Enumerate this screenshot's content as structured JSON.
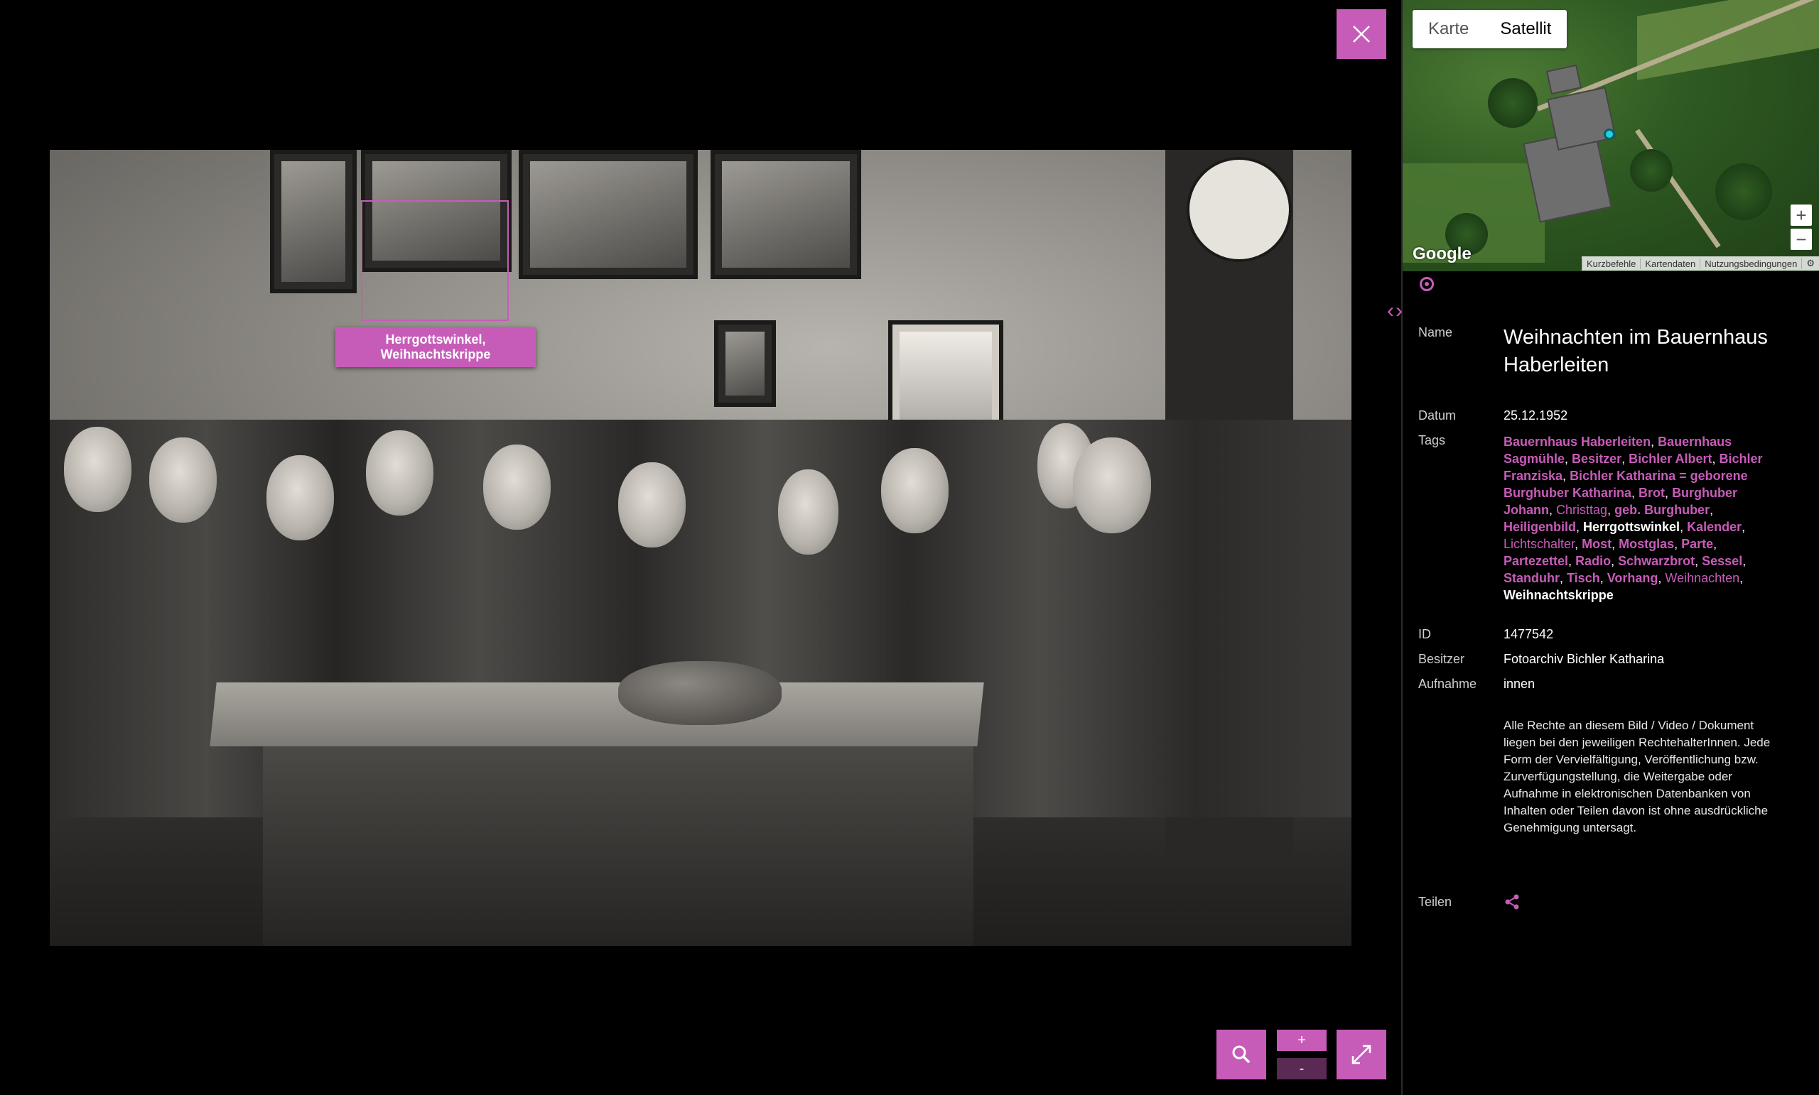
{
  "annotation": {
    "label_line1": "Herrgottswinkel,",
    "label_line2": "Weihnachtskrippe"
  },
  "viewer": {
    "close_icon": "close-icon",
    "search_icon": "magnifier-icon",
    "zoom_in_label": "+",
    "zoom_out_label": "-",
    "fullscreen_icon": "expand-icon"
  },
  "map": {
    "tab_map": "Karte",
    "tab_satellite": "Satellit",
    "active_tab": "Satellit",
    "brand": "Google",
    "footer": [
      "Kurzbefehle",
      "Kartendaten",
      "Nutzungsbedingungen"
    ],
    "zoom_in": "+",
    "zoom_out": "−"
  },
  "details": {
    "name_label": "Name",
    "name": "Weihnachten im Bauernhaus Haberleiten",
    "date_label": "Datum",
    "date": "25.12.1952",
    "tags_label": "Tags",
    "tags": [
      {
        "text": "Bauernhaus Haberleiten",
        "style": "bold"
      },
      {
        "text": "Bauernhaus Sagmühle",
        "style": "bold"
      },
      {
        "text": "Besitzer",
        "style": "bold"
      },
      {
        "text": "Bichler Albert",
        "style": "bold"
      },
      {
        "text": "Bichler Franziska",
        "style": "bold"
      },
      {
        "text": "Bichler Katharina = geborene Burghuber Katharina",
        "style": "bold"
      },
      {
        "text": "Brot",
        "style": "bold"
      },
      {
        "text": "Burghuber Johann",
        "style": "bold"
      },
      {
        "text": "Christtag",
        "style": "light"
      },
      {
        "text": "geb. Burghuber",
        "style": "bold"
      },
      {
        "text": "Heiligenbild",
        "style": "bold"
      },
      {
        "text": "Herrgottswinkel",
        "style": "selected"
      },
      {
        "text": "Kalender",
        "style": "bold"
      },
      {
        "text": "Lichtschalter",
        "style": "light"
      },
      {
        "text": "Most",
        "style": "bold"
      },
      {
        "text": "Mostglas",
        "style": "bold"
      },
      {
        "text": "Parte",
        "style": "bold"
      },
      {
        "text": "Partezettel",
        "style": "bold"
      },
      {
        "text": "Radio",
        "style": "bold"
      },
      {
        "text": "Schwarzbrot",
        "style": "bold"
      },
      {
        "text": "Sessel",
        "style": "bold"
      },
      {
        "text": "Standuhr",
        "style": "bold"
      },
      {
        "text": "Tisch",
        "style": "bold"
      },
      {
        "text": "Vorhang",
        "style": "bold"
      },
      {
        "text": "Weihnachten",
        "style": "light"
      },
      {
        "text": "Weihnachtskrippe",
        "style": "selected"
      }
    ],
    "id_label": "ID",
    "id": "1477542",
    "owner_label": "Besitzer",
    "owner": "Fotoarchiv Bichler Katharina",
    "shot_label": "Aufnahme",
    "shot": "innen",
    "rights": "Alle Rechte an diesem Bild / Video / Dokument liegen bei den jeweiligen RechtehalterInnen. Jede Form der Vervielfältigung, Veröffentlichung bzw. Zurverfügungstellung, die Weitergabe oder Aufnahme in elektronischen Datenbanken von Inhalten oder Teilen davon ist ohne ausdrückliche Genehmigung untersagt.",
    "share_label": "Teilen"
  },
  "colors": {
    "accent": "#c75cb8",
    "background": "#000000",
    "pin": "#22d3dd"
  }
}
